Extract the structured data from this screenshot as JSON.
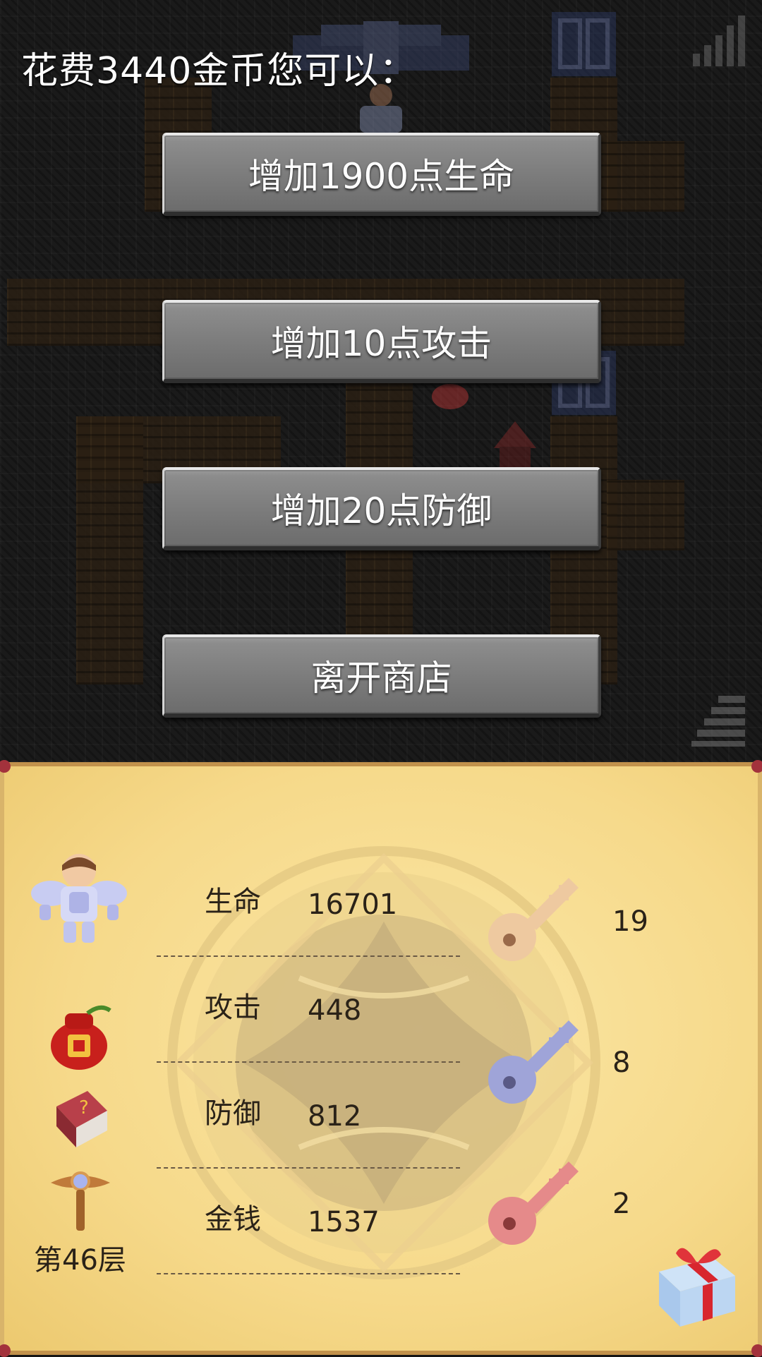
{
  "shop": {
    "title": "花费3440金币您可以：",
    "options": {
      "life": "增加1900点生命",
      "attack": "增加10点攻击",
      "defense": "增加20点防御",
      "leave": "离开商店"
    }
  },
  "status": {
    "life_label": "生命",
    "life_value": "16701",
    "attack_label": "攻击",
    "attack_value": "448",
    "defense_label": "防御",
    "defense_value": "812",
    "gold_label": "金钱",
    "gold_value": "1537",
    "floor": "第46层"
  },
  "keys": {
    "yellow": "19",
    "blue": "8",
    "red": "2"
  },
  "icons": [
    "hero-avatar-icon",
    "lucky-bag-icon",
    "monster-book-icon",
    "fly-wand-icon",
    "yellow-key-icon",
    "blue-key-icon",
    "red-key-icon",
    "gift-box-icon",
    "signal-icon",
    "stairs-icon"
  ],
  "colors": {
    "button_face": "#7b7b7b",
    "panel_bg": "#f6d98a",
    "yellow_key": "#eec9a0",
    "blue_key": "#9fa4d8",
    "red_key": "#e58a8a"
  }
}
